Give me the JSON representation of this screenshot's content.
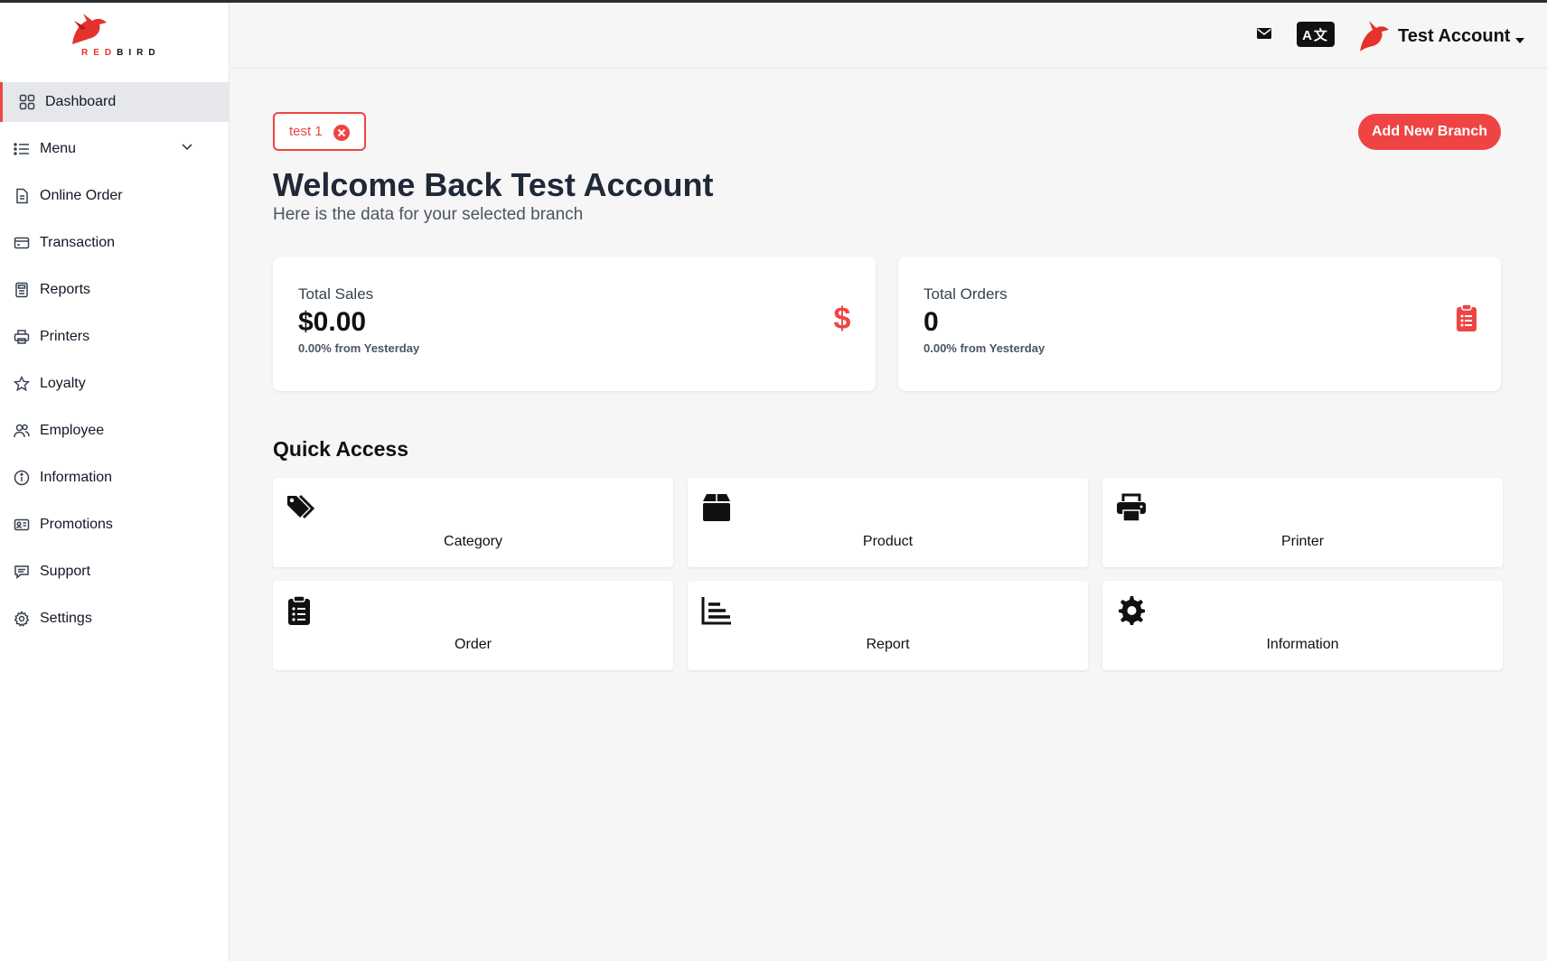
{
  "brand": {
    "logo_text_red": "RED",
    "logo_text_dark": "BIRD"
  },
  "sidebar": {
    "items": [
      {
        "label": "Dashboard",
        "icon": "grid-icon",
        "active": true
      },
      {
        "label": "Menu",
        "icon": "list-icon",
        "has_chevron": true
      },
      {
        "label": "Online Order",
        "icon": "document-icon"
      },
      {
        "label": "Transaction",
        "icon": "credit-card-icon"
      },
      {
        "label": "Reports",
        "icon": "calculator-icon"
      },
      {
        "label": "Printers",
        "icon": "printer-icon"
      },
      {
        "label": "Loyalty",
        "icon": "star-icon"
      },
      {
        "label": "Employee",
        "icon": "users-icon"
      },
      {
        "label": "Information",
        "icon": "info-icon"
      },
      {
        "label": "Promotions",
        "icon": "id-card-icon"
      },
      {
        "label": "Support",
        "icon": "chat-icon"
      },
      {
        "label": "Settings",
        "icon": "gear-icon"
      }
    ]
  },
  "header": {
    "account_name": "Test Account",
    "translate_label": "A文"
  },
  "main": {
    "branch_chip": "test 1",
    "add_branch_label": "Add New Branch",
    "welcome": "Welcome Back Test Account",
    "subtitle": "Here is the data for your selected branch",
    "stats": [
      {
        "label": "Total Sales",
        "value": "$0.00",
        "change": "0.00% from Yesterday",
        "icon": "dollar-icon"
      },
      {
        "label": "Total Orders",
        "value": "0",
        "change": "0.00% from Yesterday",
        "icon": "clipboard-list-icon"
      }
    ],
    "quick_access_title": "Quick Access",
    "quick_access": [
      {
        "label": "Category",
        "icon": "tags-icon"
      },
      {
        "label": "Product",
        "icon": "box-icon"
      },
      {
        "label": "Printer",
        "icon": "printer-icon"
      },
      {
        "label": "Order",
        "icon": "clipboard-list-icon"
      },
      {
        "label": "Report",
        "icon": "bar-chart-icon"
      },
      {
        "label": "Information",
        "icon": "gear-icon"
      }
    ]
  },
  "colors": {
    "accent": "#ef4444",
    "sidebar_active_bg": "#e5e7eb",
    "background": "#f6f6f6"
  }
}
